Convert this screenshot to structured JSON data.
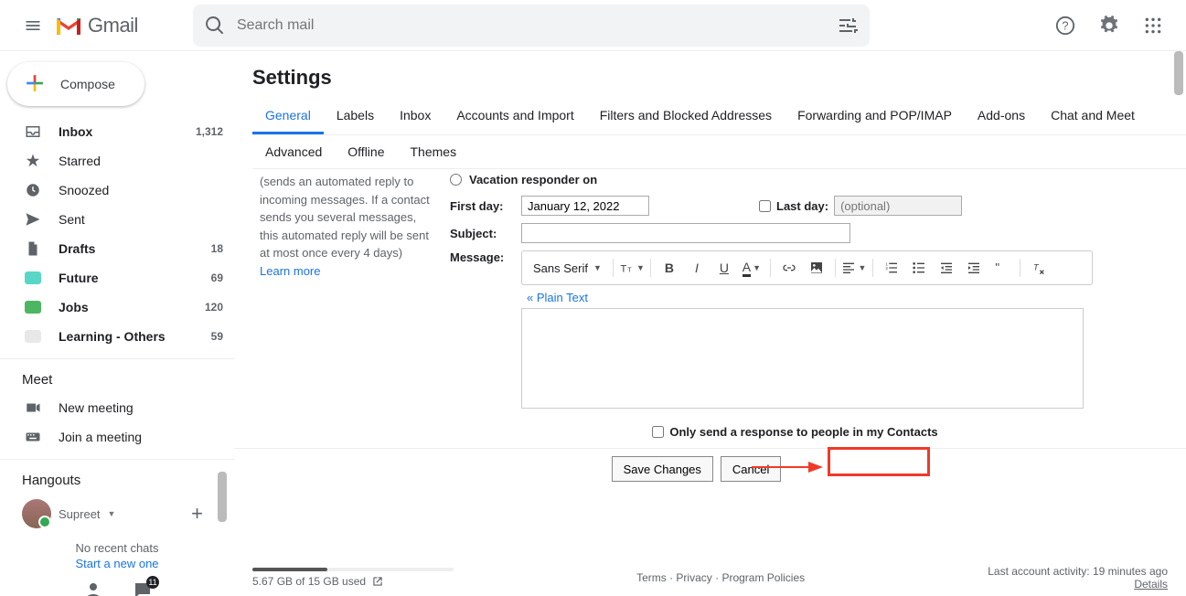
{
  "header": {
    "brand": "Gmail",
    "search_placeholder": "Search mail"
  },
  "sidebar": {
    "compose": "Compose",
    "items": [
      {
        "label": "Inbox",
        "count": "1,312",
        "icon": "inbox"
      },
      {
        "label": "Starred",
        "count": "",
        "icon": "star"
      },
      {
        "label": "Snoozed",
        "count": "",
        "icon": "clock"
      },
      {
        "label": "Sent",
        "count": "",
        "icon": "send"
      },
      {
        "label": "Drafts",
        "count": "18",
        "icon": "file"
      },
      {
        "label": "Future",
        "count": "69",
        "icon": "chip-teal"
      },
      {
        "label": "Jobs",
        "count": "120",
        "icon": "chip-green"
      },
      {
        "label": "Learning - Others",
        "count": "59",
        "icon": "chip-dim"
      }
    ],
    "meet": {
      "title": "Meet",
      "items": [
        {
          "label": "New meeting"
        },
        {
          "label": "Join a meeting"
        }
      ]
    },
    "hangouts": {
      "title": "Hangouts",
      "user": "Supreet",
      "no_recent": "No recent chats",
      "start_new": "Start a new one"
    }
  },
  "main": {
    "title": "Settings",
    "tabs_row1": [
      "General",
      "Labels",
      "Inbox",
      "Accounts and Import",
      "Filters and Blocked Addresses",
      "Forwarding and POP/IMAP",
      "Add-ons",
      "Chat and Meet"
    ],
    "tabs_row2": [
      "Advanced",
      "Offline",
      "Themes"
    ],
    "active_tab": "General",
    "vacation": {
      "help_text": "(sends an automated reply to incoming messages. If a contact sends you several messages, this automated reply will be sent at most once every 4 days)",
      "learn_more": "Learn more",
      "responder_on": "Vacation responder on",
      "first_day_label": "First day:",
      "first_day_value": "January 12, 2022",
      "last_day_label": "Last day:",
      "last_day_placeholder": "(optional)",
      "subject_label": "Subject:",
      "message_label": "Message:",
      "font_name": "Sans Serif",
      "plain_text": "« Plain Text",
      "contacts_only": "Only send a response to people in my Contacts"
    },
    "buttons": {
      "save": "Save Changes",
      "cancel": "Cancel"
    },
    "footer": {
      "storage": "5.67 GB of 15 GB used",
      "links": {
        "terms": "Terms",
        "privacy": "Privacy",
        "policies": "Program Policies"
      },
      "activity": "Last account activity: 19 minutes ago",
      "details": "Details"
    }
  }
}
